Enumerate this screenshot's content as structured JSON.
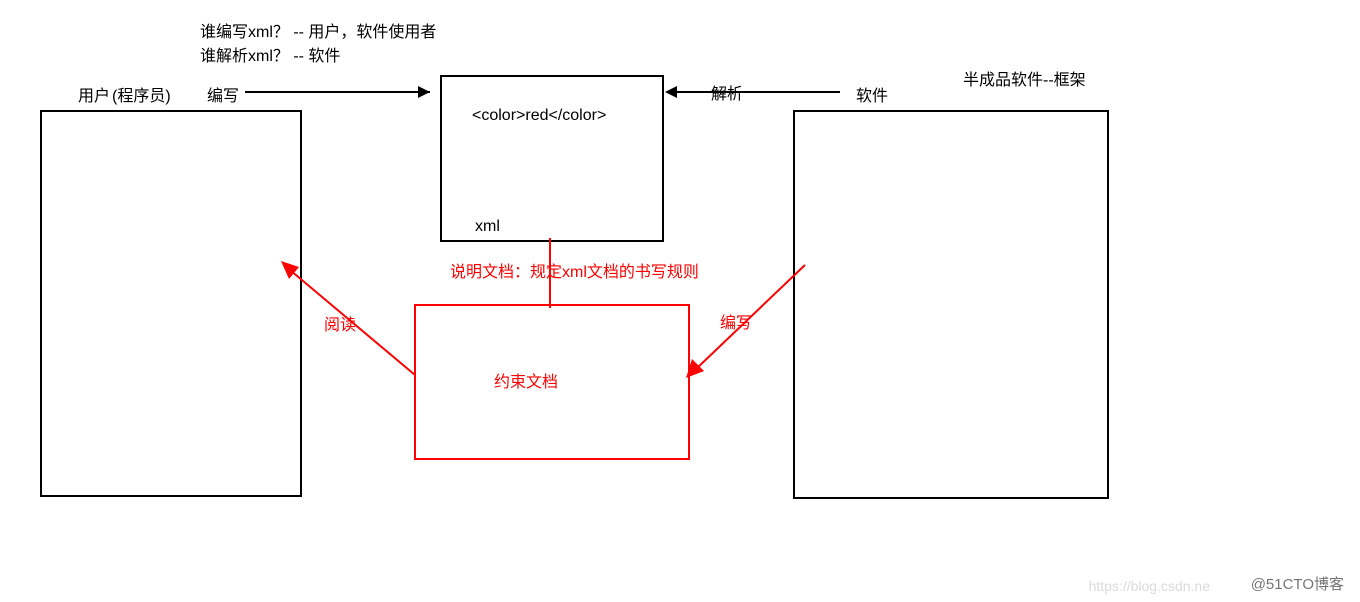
{
  "top": {
    "q1": "谁编写xml？ -- 用户，软件使用者",
    "q2": "谁解析xml？ -- 软件"
  },
  "left": {
    "role": "用户",
    "subrole": "(程序员)",
    "action": "编写"
  },
  "right": {
    "action": "解析",
    "role": "软件",
    "subtitle": "半成品软件--框架"
  },
  "xml_box": {
    "content": "<color>red</color>",
    "caption": "xml"
  },
  "middle": {
    "note": "说明文档：规定xml文档的书写规则",
    "read": "阅读",
    "write": "编写",
    "doc": "约束文档"
  },
  "watermark": {
    "left": "https://blog.csdn.ne",
    "right": "@51CTO博客"
  }
}
